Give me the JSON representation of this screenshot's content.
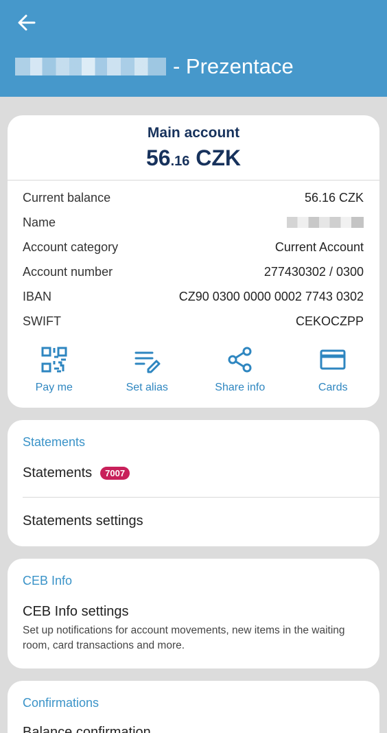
{
  "header": {
    "title_suffix": "- Prezentace",
    "background": "#4698cb",
    "back_icon": "arrow-left-icon"
  },
  "account": {
    "name": "Main account",
    "balance_main": "56",
    "balance_cents": ".16",
    "balance_currency": " CZK",
    "rows": [
      {
        "label": "Current balance",
        "value": "56.16 CZK"
      },
      {
        "label": "Name",
        "value": ""
      },
      {
        "label": "Account category",
        "value": "Current Account"
      },
      {
        "label": "Account number",
        "value": "277430302 / 0300"
      },
      {
        "label": "IBAN",
        "value": "CZ90 0300 0000 0002 7743 0302"
      },
      {
        "label": "SWIFT",
        "value": "CEKOCZPP"
      }
    ],
    "actions": [
      {
        "label": "Pay me",
        "icon": "qr-code-icon"
      },
      {
        "label": "Set alias",
        "icon": "edit-lines-icon"
      },
      {
        "label": "Share info",
        "icon": "share-icon"
      },
      {
        "label": "Cards",
        "icon": "credit-card-icon"
      }
    ]
  },
  "statements": {
    "section_title": "Statements",
    "items": [
      {
        "label": "Statements",
        "badge": "7007"
      },
      {
        "label": "Statements settings"
      }
    ]
  },
  "ceb_info": {
    "section_title": "CEB Info",
    "item_label": "CEB Info settings",
    "description": "Set up notifications for account movements, new items in the waiting room, card transactions and more."
  },
  "confirmations": {
    "section_title": "Confirmations",
    "item_label": "Balance confirmation"
  },
  "colors": {
    "accent": "#2e86c0",
    "navy": "#17325c",
    "badge": "#c8205a"
  }
}
